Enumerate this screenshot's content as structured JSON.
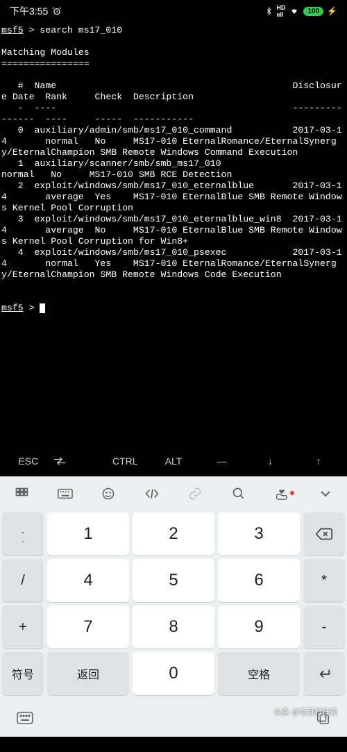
{
  "statusbar": {
    "time": "下午3:55",
    "battery": "100",
    "icons": {
      "alarm": true,
      "bt": true,
      "hd": true,
      "signal": true,
      "wifi": true,
      "charging": true
    }
  },
  "terminal": {
    "prompt1": "msf5",
    "prompt_sep": " > ",
    "command1": "search ms17_010",
    "heading": "Matching Modules",
    "underline": "================",
    "col_header1": "   #  Name                                           Disclosure Date  Rank     Check  Description",
    "col_header2": "   -  ----                                           ---------------  ----     -----  -----------",
    "row0": "   0  auxiliary/admin/smb/ms17_010_command           2017-03-14       normal   No     MS17-010 EternalRomance/EternalSynergy/EternalChampion SMB Remote Windows Command Execution",
    "row1": "   1  auxiliary/scanner/smb/smb_ms17_010                              normal   No     MS17-010 SMB RCE Detection",
    "row2": "   2  exploit/windows/smb/ms17_010_eternalblue       2017-03-14       average  Yes    MS17-010 EternalBlue SMB Remote Windows Kernel Pool Corruption",
    "row3": "   3  exploit/windows/smb/ms17_010_eternalblue_win8  2017-03-14       average  No     MS17-010 EternalBlue SMB Remote Windows Kernel Pool Corruption for Win8+",
    "row4": "   4  exploit/windows/smb/ms17_010_psexec            2017-03-14       normal   Yes    MS17-010 EternalRomance/EternalSynergy/EternalChampion SMB Remote Windows Code Execution",
    "prompt2": "msf5",
    "command2": ""
  },
  "extrakeys": {
    "esc": "ESC",
    "tab": "⇄",
    "ctrl": "CTRL",
    "alt": "ALT",
    "dash": "—",
    "down": "↓",
    "up": "↑"
  },
  "keyboard": {
    "side_left": [
      {
        "top": ".",
        "bot": ","
      },
      {
        "top": "/",
        "bot": ""
      },
      {
        "top": "+",
        "bot": ""
      },
      {
        "txt": "符号"
      }
    ],
    "nums": {
      "r1": [
        "1",
        "2",
        "3"
      ],
      "r2": [
        "4",
        "5",
        "6"
      ],
      "r3": [
        "7",
        "8",
        "9"
      ],
      "r4": [
        "返回",
        "0",
        "空格"
      ]
    },
    "side_right": [
      {
        "icon": "backspace"
      },
      {
        "txt": "*"
      },
      {
        "txt": "-"
      },
      {
        "icon": "enter"
      }
    ]
  },
  "watermark": "头条 @毛哥科技秀"
}
